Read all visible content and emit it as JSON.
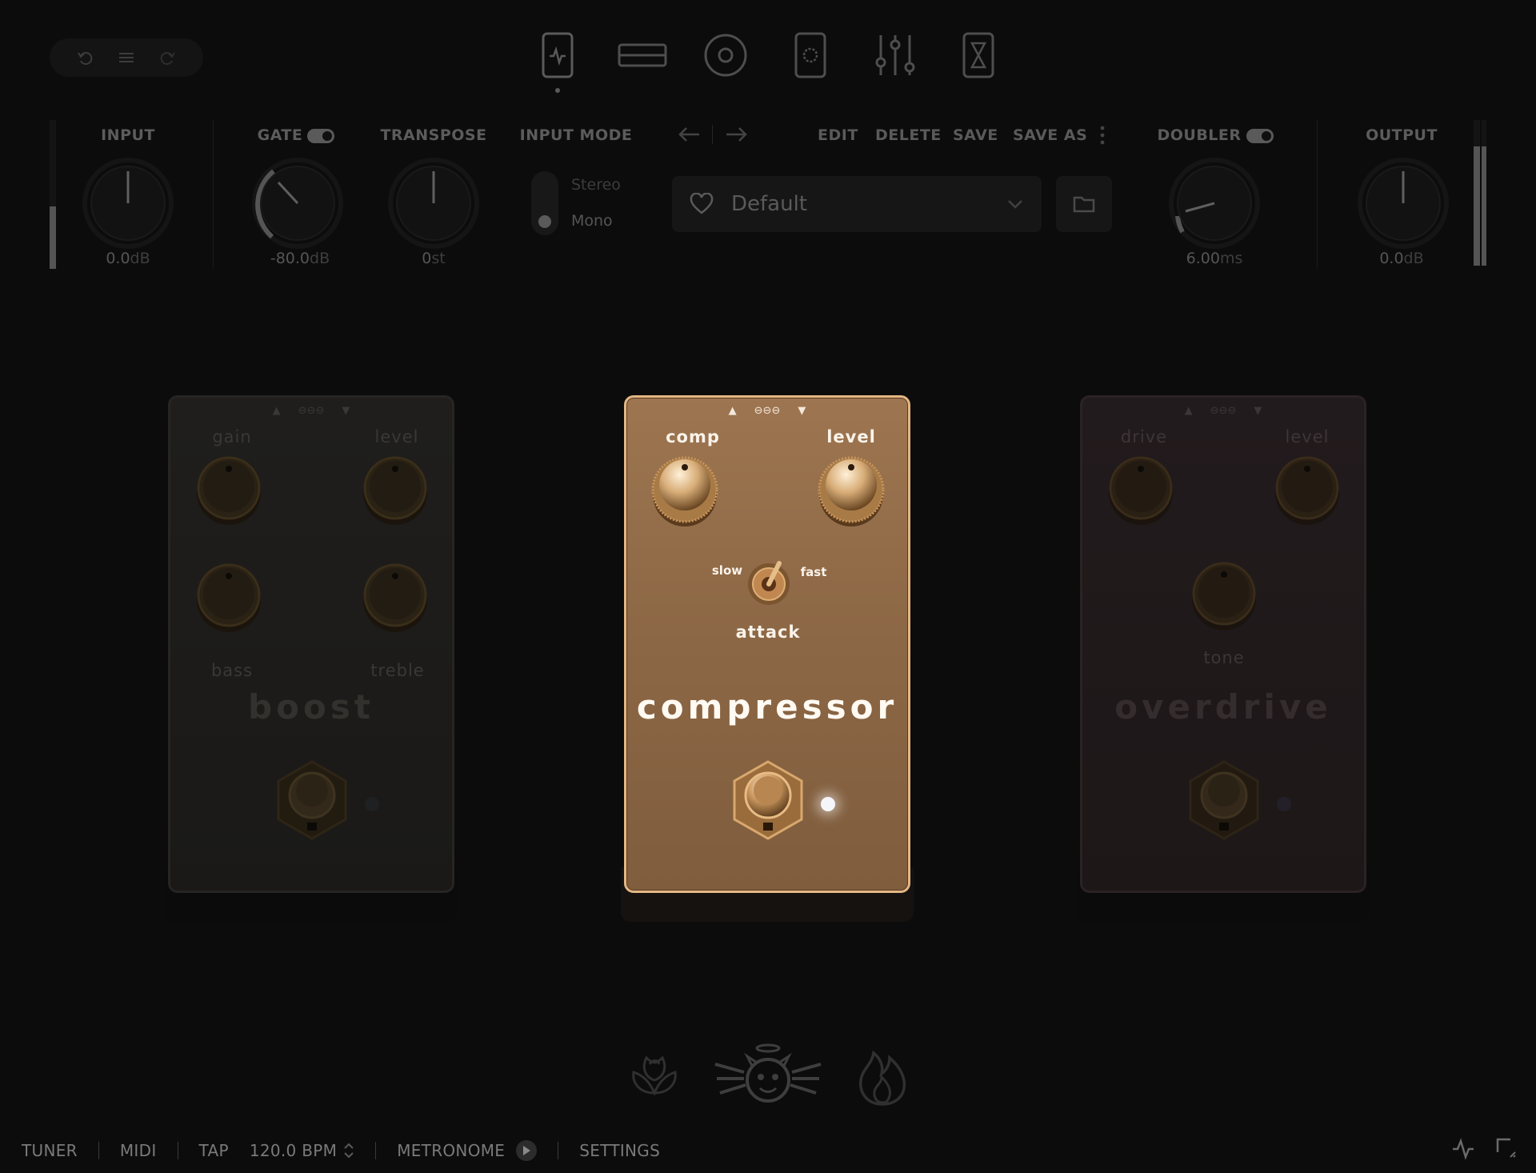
{
  "toolbar": {
    "undo_icon": "undo-icon",
    "menu_icon": "menu-icon",
    "redo_icon": "redo-icon",
    "views": [
      "stomp-view-icon",
      "rack-view-icon",
      "speaker-view-icon",
      "cabinet-view-icon",
      "mixer-view-icon",
      "timer-view-icon"
    ],
    "active_view": 0
  },
  "header": {
    "input": {
      "label": "INPUT",
      "value": "0.0",
      "unit": "dB",
      "meter_level": 0.42
    },
    "gate": {
      "label": "GATE",
      "value": "-80.0",
      "unit": "dB",
      "enabled": true
    },
    "transpose": {
      "label": "TRANSPOSE",
      "value": "0",
      "unit": "st"
    },
    "input_mode": {
      "label": "INPUT MODE",
      "options": [
        "Stereo",
        "Mono"
      ],
      "selected": "Mono"
    },
    "preset": {
      "prev_icon": "arrow-left-icon",
      "next_icon": "arrow-right-icon",
      "actions": [
        "EDIT",
        "DELETE",
        "SAVE",
        "SAVE AS"
      ],
      "name": "Default"
    },
    "doubler": {
      "label": "DOUBLER",
      "value": "6.00",
      "unit": "ms",
      "enabled": true
    },
    "output": {
      "label": "OUTPUT",
      "value": "0.0",
      "unit": "dB",
      "meter_level": 0.82
    }
  },
  "pedals": {
    "boost": {
      "title": "boost",
      "knobs": [
        "gain",
        "level",
        "bass",
        "treble"
      ],
      "active": false
    },
    "compressor": {
      "title": "compressor",
      "knobs": [
        "comp",
        "level"
      ],
      "switch_label": "attack",
      "switch_left": "slow",
      "switch_right": "fast",
      "active": true
    },
    "overdrive": {
      "title": "overdrive",
      "knobs": [
        "drive",
        "level",
        "tone"
      ],
      "active": false
    }
  },
  "categories": [
    "rose-icon",
    "angel-devil-icon",
    "flame-icon"
  ],
  "status_bar": {
    "tuner": "TUNER",
    "midi": "MIDI",
    "tap": "TAP",
    "bpm": "120.0 BPM",
    "metronome": "METRONOME",
    "settings": "SETTINGS"
  },
  "colors": {
    "accent_gold": "#e4b784",
    "pedal_gold": "#8c6745",
    "background": "#0c0c0c"
  }
}
